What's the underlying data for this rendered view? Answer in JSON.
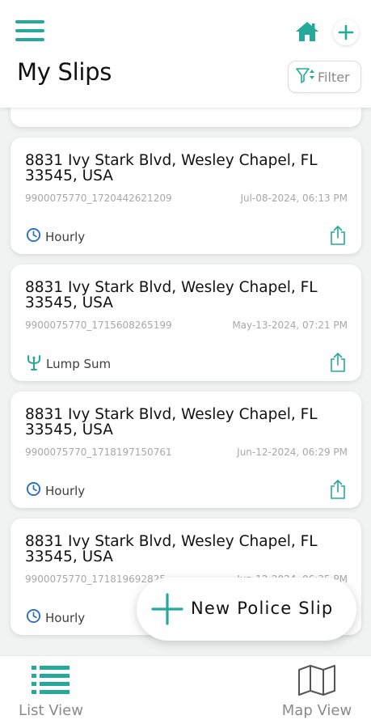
{
  "header": {
    "title": "My Slips",
    "filter_label": "Filter"
  },
  "colors": {
    "accent": "#25a99a",
    "hourly_icon": "#2a6fbf"
  },
  "slips": [
    {
      "address": "8831 Ivy Stark Blvd, Wesley Chapel, FL 33545, USA",
      "slip_id": "9900075770_1720442621209",
      "date": "Jul-08-2024, 06:13 PM",
      "rate_type": "Hourly",
      "rate_icon": "clock-icon"
    },
    {
      "address": "8831 Ivy Stark Blvd, Wesley Chapel, FL 33545, USA",
      "slip_id": "9900075770_1715608265199",
      "date": "May-13-2024, 07:21 PM",
      "rate_type": "Lump Sum",
      "rate_icon": "trident-icon"
    },
    {
      "address": "8831 Ivy Stark Blvd, Wesley Chapel, FL 33545, USA",
      "slip_id": "9900075770_1718197150761",
      "date": "Jun-12-2024, 06:29 PM",
      "rate_type": "Hourly",
      "rate_icon": "clock-icon"
    },
    {
      "address": "8831 Ivy Stark Blvd, Wesley Chapel, FL 33545, USA",
      "slip_id": "9900075770_171819692825",
      "date": "Jun-12-2024, 06:35 PM",
      "rate_type": "Hourly",
      "rate_icon": "clock-icon"
    }
  ],
  "fab": {
    "label": "New Police Slip"
  },
  "bottom_nav": {
    "list_view": "List View",
    "map_view": "Map View"
  }
}
